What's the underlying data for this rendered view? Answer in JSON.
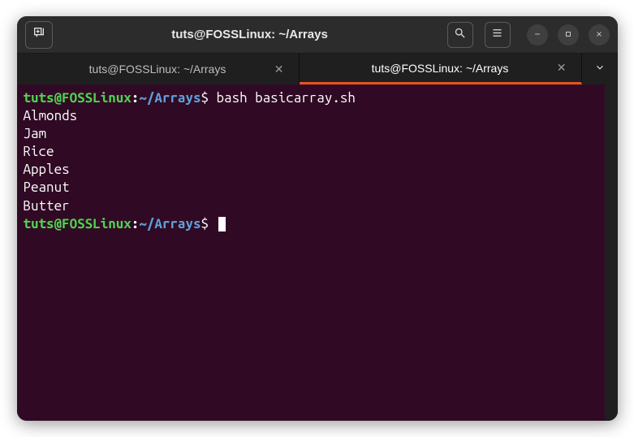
{
  "window": {
    "title": "tuts@FOSSLinux: ~/Arrays"
  },
  "tabs": [
    {
      "label": "tuts@FOSSLinux: ~/Arrays",
      "active": false
    },
    {
      "label": "tuts@FOSSLinux: ~/Arrays",
      "active": true
    }
  ],
  "prompt": {
    "user_host": "tuts@FOSSLinux",
    "colon": ":",
    "path": "~/Arrays",
    "symbol": "$"
  },
  "lines": [
    {
      "type": "prompt",
      "command": "bash basicarray.sh"
    },
    {
      "type": "output",
      "text": "Almonds"
    },
    {
      "type": "output",
      "text": "Jam"
    },
    {
      "type": "output",
      "text": "Rice"
    },
    {
      "type": "output",
      "text": "Apples"
    },
    {
      "type": "output",
      "text": "Peanut"
    },
    {
      "type": "output",
      "text": "Butter"
    },
    {
      "type": "prompt",
      "command": "",
      "cursor": true
    }
  ]
}
